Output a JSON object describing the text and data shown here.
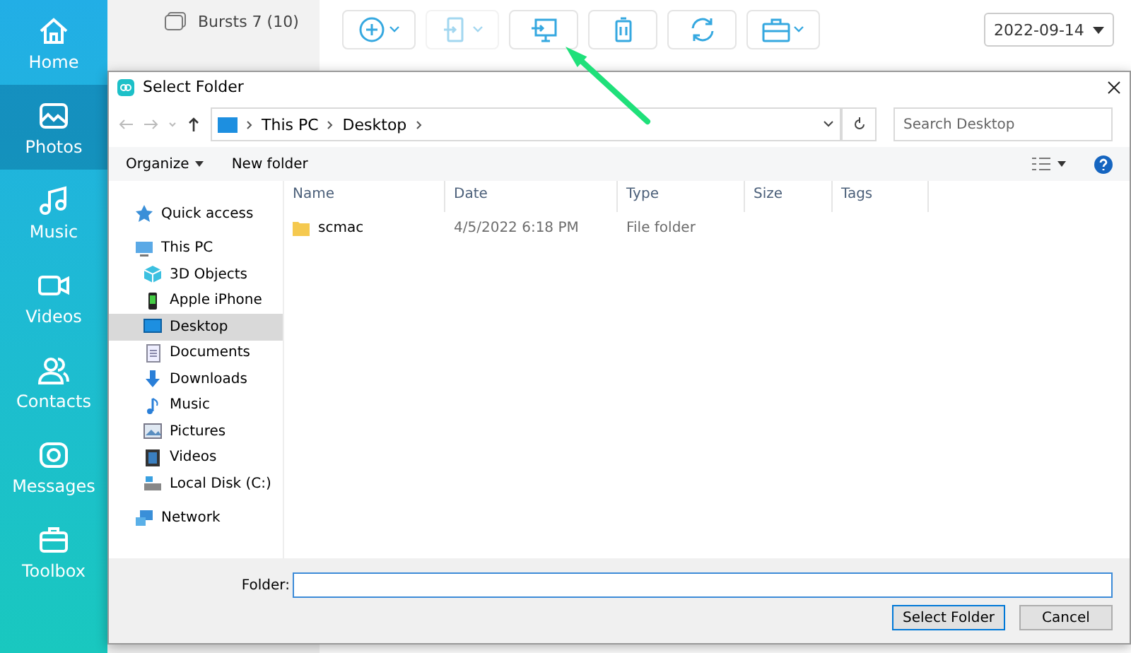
{
  "sidebar": {
    "items": [
      {
        "label": "Home",
        "kind": "home",
        "selected": false
      },
      {
        "label": "Photos",
        "kind": "photos",
        "selected": true
      },
      {
        "label": "Music",
        "kind": "music",
        "selected": false
      },
      {
        "label": "Videos",
        "kind": "videos",
        "selected": false
      },
      {
        "label": "Contacts",
        "kind": "contacts",
        "selected": false
      },
      {
        "label": "Messages",
        "kind": "messages",
        "selected": false
      },
      {
        "label": "Toolbox",
        "kind": "toolbox",
        "selected": false
      }
    ]
  },
  "album_list": [
    {
      "label": "Bursts 7 (10)"
    }
  ],
  "toolbar": {
    "buttons": [
      {
        "kind": "add",
        "dropdown": true,
        "disabled": false
      },
      {
        "kind": "to-device",
        "dropdown": true,
        "disabled": true
      },
      {
        "kind": "to-pc",
        "dropdown": false,
        "disabled": false
      },
      {
        "kind": "delete",
        "dropdown": false,
        "disabled": false
      },
      {
        "kind": "refresh",
        "dropdown": false,
        "disabled": false
      },
      {
        "kind": "toolbox",
        "dropdown": true,
        "disabled": false
      }
    ],
    "date": "2022-09-14"
  },
  "dialog": {
    "title": "Select Folder",
    "address": {
      "path": [
        "This PC",
        "Desktop"
      ]
    },
    "search": {
      "placeholder": "Search Desktop"
    },
    "commands": [
      "Organize",
      "New folder"
    ],
    "nav": [
      {
        "label": "Quick access",
        "kind": "star",
        "selected": false
      },
      {
        "label": "This PC",
        "kind": "pc",
        "selected": false,
        "children": [
          {
            "label": "3D Objects",
            "kind": "cube",
            "selected": false
          },
          {
            "label": "Apple iPhone",
            "kind": "phone",
            "selected": false
          },
          {
            "label": "Desktop",
            "kind": "desktop",
            "selected": true
          },
          {
            "label": "Documents",
            "kind": "document",
            "selected": false
          },
          {
            "label": "Downloads",
            "kind": "download",
            "selected": false
          },
          {
            "label": "Music",
            "kind": "music",
            "selected": false
          },
          {
            "label": "Pictures",
            "kind": "picture",
            "selected": false
          },
          {
            "label": "Videos",
            "kind": "video",
            "selected": false
          },
          {
            "label": "Local Disk (C:)",
            "kind": "disk",
            "selected": false
          }
        ]
      },
      {
        "label": "Network",
        "kind": "network",
        "selected": false
      }
    ],
    "columns": [
      "Name",
      "Date",
      "Type",
      "Size",
      "Tags"
    ],
    "rows": [
      {
        "name": "scmac",
        "date": "4/5/2022 6:18 PM",
        "type": "File folder"
      }
    ],
    "folder_label": "Folder:",
    "buttons": [
      "Select Folder",
      "Cancel"
    ]
  }
}
